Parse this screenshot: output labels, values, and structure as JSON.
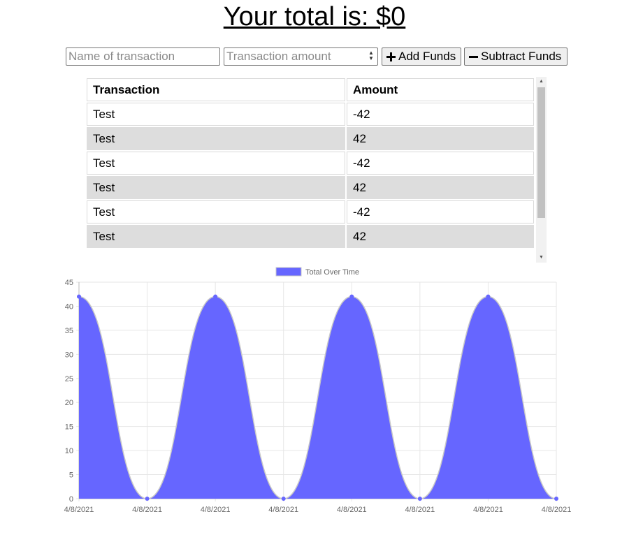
{
  "header": {
    "total_text": "Your total is: $0"
  },
  "form": {
    "name_placeholder": "Name of transaction",
    "amount_placeholder": "Transaction amount",
    "add_label": "Add Funds",
    "subtract_label": "Subtract Funds"
  },
  "table": {
    "headers": [
      "Transaction",
      "Amount"
    ],
    "rows": [
      {
        "name": "Test",
        "amount": "-42"
      },
      {
        "name": "Test",
        "amount": "42"
      },
      {
        "name": "Test",
        "amount": "-42"
      },
      {
        "name": "Test",
        "amount": "42"
      },
      {
        "name": "Test",
        "amount": "-42"
      },
      {
        "name": "Test",
        "amount": "42"
      }
    ]
  },
  "colors": {
    "series_fill": "#6666ff",
    "series_point": "#6666ff",
    "grid": "#e6e6e6",
    "row_alt": "#dddddd"
  },
  "chart_data": {
    "type": "area",
    "title": "",
    "xlabel": "",
    "ylabel": "",
    "x": [
      "4/8/2021",
      "4/8/2021",
      "4/8/2021",
      "4/8/2021",
      "4/8/2021",
      "4/8/2021",
      "4/8/2021",
      "4/8/2021"
    ],
    "series": [
      {
        "name": "Total Over Time",
        "values": [
          42,
          0,
          42,
          0,
          42,
          0,
          42,
          0
        ]
      }
    ],
    "ylim": [
      0,
      45
    ],
    "yticks": [
      0,
      5,
      10,
      15,
      20,
      25,
      30,
      35,
      40,
      45
    ],
    "grid": true,
    "legend_position": "top-center"
  }
}
